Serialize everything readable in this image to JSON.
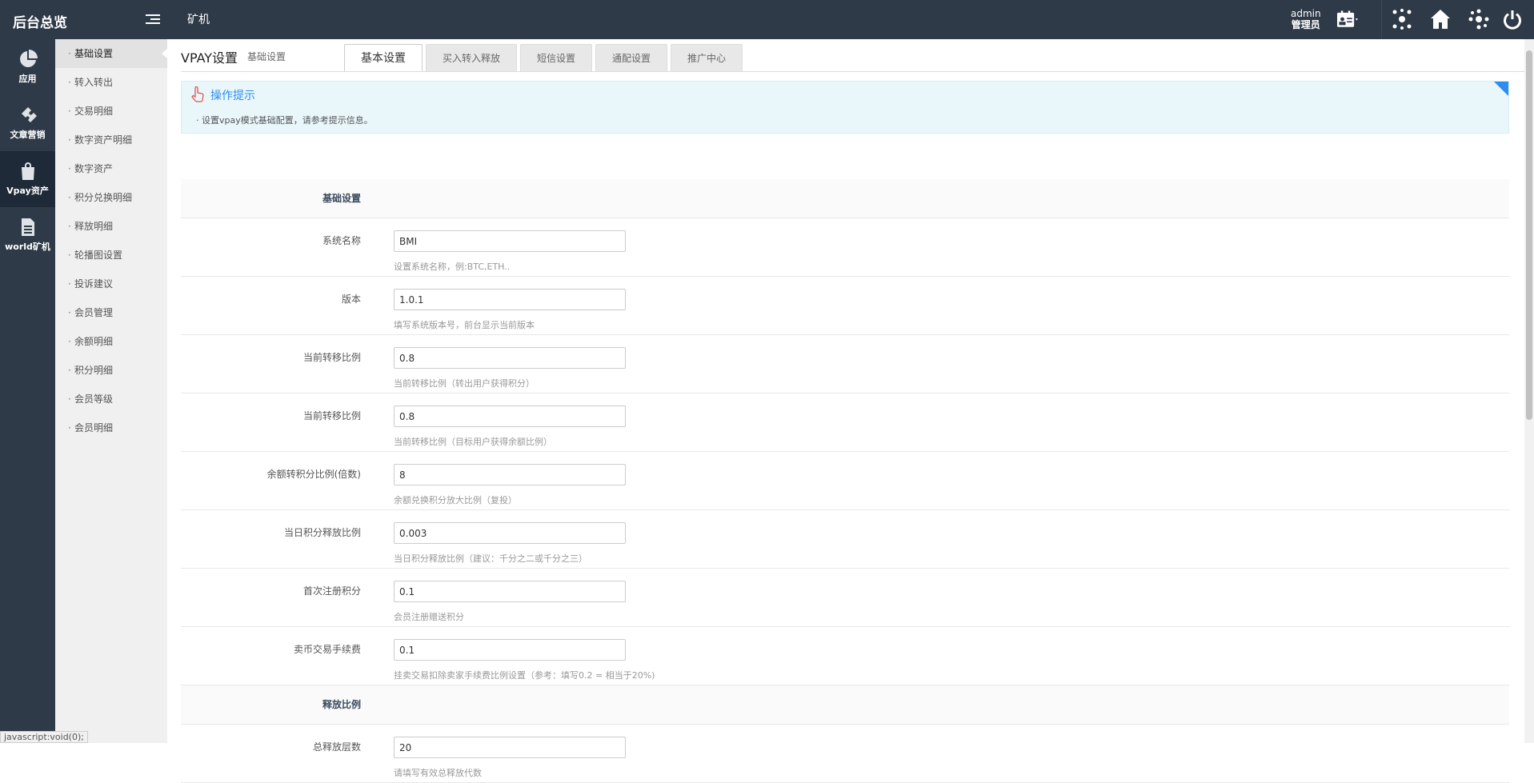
{
  "topbar": {
    "brand": "后台总览",
    "nav": "矿机",
    "user_name": "admin",
    "user_role": "管理员"
  },
  "sidebar": {
    "items": [
      {
        "label": "应用",
        "icon": "pie-chart-icon"
      },
      {
        "label": "文章营销",
        "icon": "puzzle-icon"
      },
      {
        "label": "Vpay资产",
        "icon": "shopping-bag-icon"
      },
      {
        "label": "world矿机",
        "icon": "document-icon"
      }
    ]
  },
  "submenu": {
    "items": [
      "基础设置",
      "转入转出",
      "交易明细",
      "数字资产明细",
      "数字资产",
      "积分兑换明细",
      "释放明细",
      "轮播图设置",
      "投诉建议",
      "会员管理",
      "余额明细",
      "积分明细",
      "会员等级",
      "会员明细"
    ]
  },
  "main": {
    "title": "VPAY设置",
    "subtitle": "基础设置",
    "tabs": [
      "基本设置",
      "买入转入释放",
      "短信设置",
      "通配设置",
      "推广中心"
    ],
    "tip": {
      "title": "操作提示",
      "text": "设置vpay模式基础配置，请参考提示信息。"
    }
  },
  "form": {
    "section1": "基础设置",
    "fields": [
      {
        "label": "系统名称",
        "value": "BMI",
        "hint": "设置系统名称，例:BTC,ETH.."
      },
      {
        "label": "版本",
        "value": "1.0.1",
        "hint": "填写系统版本号，前台显示当前版本"
      },
      {
        "label": "当前转移比例",
        "value": "0.8",
        "hint": "当前转移比例（转出用户获得积分）"
      },
      {
        "label": "当前转移比例",
        "value": "0.8",
        "hint": "当前转移比例（目标用户获得余额比例）"
      },
      {
        "label": "余额转积分比例(倍数)",
        "value": "8",
        "hint": "余额兑换积分放大比例（复投）"
      },
      {
        "label": "当日积分释放比例",
        "value": "0.003",
        "hint": "当日积分释放比例（建议：千分之二或千分之三）"
      },
      {
        "label": "首次注册积分",
        "value": "0.1",
        "hint": "会员注册赠送积分"
      },
      {
        "label": "卖币交易手续费",
        "value": "0.1",
        "hint": "挂卖交易扣除卖家手续费比例设置（参考：填写0.2 = 相当于20%)"
      }
    ],
    "section2": "释放比例",
    "fields2": [
      {
        "label": "总释放层数",
        "value": "20",
        "hint": "请填写有效总释放代数"
      }
    ]
  },
  "status": "javascript:void(0);"
}
